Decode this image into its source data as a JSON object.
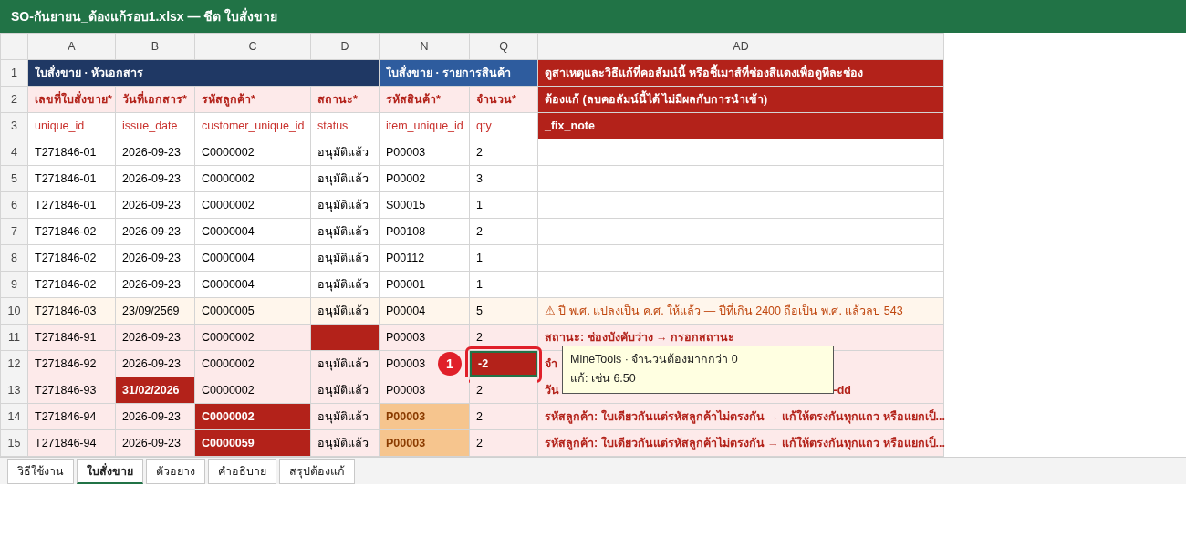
{
  "window": {
    "title": "SO-กันยายน_ต้องแก้รอบ1.xlsx — ชีต ใบสั่งขาย"
  },
  "columns": [
    "A",
    "B",
    "C",
    "D",
    "N",
    "Q",
    "AD"
  ],
  "row_numbers": [
    "1",
    "2",
    "3",
    "4",
    "5",
    "6",
    "7",
    "8",
    "9",
    "10",
    "11",
    "12",
    "13",
    "14",
    "15"
  ],
  "group_headers": [
    {
      "text": "ใบสั่งขาย · หัวเอกสาร",
      "kind": "doc"
    },
    {
      "text": "ใบสั่งขาย · รายการสินค้า",
      "kind": "item"
    },
    {
      "text": "ดูสาเหตุและวิธีแก้ที่คอลัมน์นี้ หรือชี้เมาส์ที่ช่องสีแดงเพื่อดูทีละช่อง",
      "kind": "fix"
    }
  ],
  "labels": [
    {
      "text": "เลขที่ใบสั่งขาย*",
      "kind": "label"
    },
    {
      "text": "วันที่เอกสาร*",
      "kind": "label"
    },
    {
      "text": "รหัสลูกค้า*",
      "kind": "label"
    },
    {
      "text": "สถานะ*",
      "kind": "label"
    },
    {
      "text": "รหัสสินค้า*",
      "kind": "label"
    },
    {
      "text": "จำนวน*",
      "kind": "label"
    },
    {
      "text": "ต้องแก้ (ลบคอลัมน์นี้ได้ ไม่มีผลกับการนำเข้า)",
      "kind": "fix"
    }
  ],
  "fields": [
    {
      "text": "unique_id",
      "kind": "field"
    },
    {
      "text": "issue_date",
      "kind": "field"
    },
    {
      "text": "customer_unique_id",
      "kind": "field"
    },
    {
      "text": "status",
      "kind": "field"
    },
    {
      "text": "item_unique_id",
      "kind": "field"
    },
    {
      "text": "qty",
      "kind": "field"
    },
    {
      "text": "_fix_note",
      "kind": "fix"
    }
  ],
  "rows": [
    {
      "kind": "ok",
      "cells": [
        {
          "t": "T271846-01",
          "kind": "ok",
          "selected": false
        },
        {
          "t": "2026-09-23",
          "kind": "ok",
          "selected": false
        },
        {
          "t": "C0000002",
          "kind": "ok",
          "selected": false
        },
        {
          "t": "อนุมัติแล้ว",
          "kind": "ok",
          "selected": false
        },
        {
          "t": "P00003",
          "kind": "ok",
          "selected": false
        },
        {
          "t": "2",
          "kind": "ok",
          "selected": false
        }
      ]
    },
    {
      "kind": "ok",
      "cells": [
        {
          "t": "T271846-01",
          "kind": "ok",
          "selected": false
        },
        {
          "t": "2026-09-23",
          "kind": "ok",
          "selected": false
        },
        {
          "t": "C0000002",
          "kind": "ok",
          "selected": false
        },
        {
          "t": "อนุมัติแล้ว",
          "kind": "ok",
          "selected": false
        },
        {
          "t": "P00002",
          "kind": "ok",
          "selected": false
        },
        {
          "t": "3",
          "kind": "ok",
          "selected": false
        }
      ]
    },
    {
      "kind": "ok",
      "cells": [
        {
          "t": "T271846-01",
          "kind": "ok",
          "selected": false
        },
        {
          "t": "2026-09-23",
          "kind": "ok",
          "selected": false
        },
        {
          "t": "C0000002",
          "kind": "ok",
          "selected": false
        },
        {
          "t": "อนุมัติแล้ว",
          "kind": "ok",
          "selected": false
        },
        {
          "t": "S00015",
          "kind": "ok",
          "selected": false
        },
        {
          "t": "1",
          "kind": "ok",
          "selected": false
        }
      ]
    },
    {
      "kind": "ok",
      "cells": [
        {
          "t": "T271846-02",
          "kind": "ok",
          "selected": false
        },
        {
          "t": "2026-09-23",
          "kind": "ok",
          "selected": false
        },
        {
          "t": "C0000004",
          "kind": "ok",
          "selected": false
        },
        {
          "t": "อนุมัติแล้ว",
          "kind": "ok",
          "selected": false
        },
        {
          "t": "P00108",
          "kind": "ok",
          "selected": false
        },
        {
          "t": "2",
          "kind": "ok",
          "selected": false
        }
      ]
    },
    {
      "kind": "ok",
      "cells": [
        {
          "t": "T271846-02",
          "kind": "ok",
          "selected": false
        },
        {
          "t": "2026-09-23",
          "kind": "ok",
          "selected": false
        },
        {
          "t": "C0000004",
          "kind": "ok",
          "selected": false
        },
        {
          "t": "อนุมัติแล้ว",
          "kind": "ok",
          "selected": false
        },
        {
          "t": "P00112",
          "kind": "ok",
          "selected": false
        },
        {
          "t": "1",
          "kind": "ok",
          "selected": false
        }
      ]
    },
    {
      "kind": "ok",
      "cells": [
        {
          "t": "T271846-02",
          "kind": "ok",
          "selected": false
        },
        {
          "t": "2026-09-23",
          "kind": "ok",
          "selected": false
        },
        {
          "t": "C0000004",
          "kind": "ok",
          "selected": false
        },
        {
          "t": "อนุมัติแล้ว",
          "kind": "ok",
          "selected": false
        },
        {
          "t": "P00001",
          "kind": "ok",
          "selected": false
        },
        {
          "t": "1",
          "kind": "ok",
          "selected": false
        }
      ]
    },
    {
      "kind": "warn",
      "note": {
        "t": "⚠ ปี พ.ศ. แปลงเป็น ค.ศ. ให้แล้ว — ปีที่เกิน 2400 ถือเป็น พ.ศ. แล้วลบ 543",
        "kind": "warn"
      },
      "cells": [
        {
          "t": "T271846-03",
          "kind": "ok",
          "selected": false
        },
        {
          "t": "23/09/2569",
          "kind": "ok",
          "selected": false
        },
        {
          "t": "C0000005",
          "kind": "ok",
          "selected": false
        },
        {
          "t": "อนุมัติแล้ว",
          "kind": "ok",
          "selected": false
        },
        {
          "t": "P00004",
          "kind": "ok",
          "selected": false
        },
        {
          "t": "5",
          "kind": "ok",
          "selected": false
        }
      ]
    },
    {
      "kind": "error",
      "note": {
        "t": "สถานะ: ช่องบังคับว่าง → กรอกสถานะ",
        "kind": "error"
      },
      "cells": [
        {
          "t": "T271846-91",
          "kind": "ok",
          "selected": false
        },
        {
          "t": "2026-09-23",
          "kind": "ok",
          "selected": false
        },
        {
          "t": "C0000002",
          "kind": "ok",
          "selected": false
        },
        {
          "kind": "error",
          "selected": false
        },
        {
          "t": "P00003",
          "kind": "ok",
          "selected": false
        },
        {
          "t": "2",
          "kind": "ok",
          "selected": false
        }
      ]
    },
    {
      "kind": "error",
      "note": {
        "t": "จำ",
        "kind": "error"
      },
      "cells": [
        {
          "t": "T271846-92",
          "kind": "ok",
          "selected": false
        },
        {
          "t": "2026-09-23",
          "kind": "ok",
          "selected": false
        },
        {
          "t": "C0000002",
          "kind": "ok",
          "selected": false
        },
        {
          "t": "อนุมัติแล้ว",
          "kind": "ok",
          "selected": false
        },
        {
          "t": "P00003",
          "kind": "ok",
          "selected": false
        },
        {
          "t": "-2",
          "kind": "error",
          "selected": true,
          "badge": "1"
        }
      ]
    },
    {
      "kind": "error",
      "note": {
        "t": "วัน",
        "end": "-dd",
        "kind": "error"
      },
      "cells": [
        {
          "t": "T271846-93",
          "kind": "ok",
          "selected": false
        },
        {
          "t": "31/02/2026",
          "kind": "error",
          "selected": false
        },
        {
          "t": "C0000002",
          "kind": "ok",
          "selected": false
        },
        {
          "t": "อนุมัติแล้ว",
          "kind": "ok",
          "selected": false
        },
        {
          "t": "P00003",
          "kind": "ok",
          "selected": false
        },
        {
          "t": "2",
          "kind": "ok",
          "selected": false
        }
      ]
    },
    {
      "kind": "error",
      "note": {
        "t": "รหัสลูกค้า: ใบเดียวกันแต่รหัสลูกค้าไม่ตรงกัน → แก้ให้ตรงกันทุกแถว หรือแยกเป็...",
        "kind": "error"
      },
      "cells": [
        {
          "t": "T271846-94",
          "kind": "ok",
          "selected": false
        },
        {
          "t": "2026-09-23",
          "kind": "ok",
          "selected": false
        },
        {
          "t": "C0000002",
          "kind": "error",
          "selected": false
        },
        {
          "t": "อนุมัติแล้ว",
          "kind": "ok",
          "selected": false
        },
        {
          "t": "P00003",
          "kind": "warn",
          "selected": false
        },
        {
          "t": "2",
          "kind": "ok",
          "selected": false
        }
      ]
    },
    {
      "kind": "error",
      "note": {
        "t": "รหัสลูกค้า: ใบเดียวกันแต่รหัสลูกค้าไม่ตรงกัน → แก้ให้ตรงกันทุกแถว หรือแยกเป็...",
        "kind": "error"
      },
      "cells": [
        {
          "t": "T271846-94",
          "kind": "ok",
          "selected": false
        },
        {
          "t": "2026-09-23",
          "kind": "ok",
          "selected": false
        },
        {
          "t": "C0000059",
          "kind": "error",
          "selected": false
        },
        {
          "t": "อนุมัติแล้ว",
          "kind": "ok",
          "selected": false
        },
        {
          "t": "P00003",
          "kind": "warn",
          "selected": false
        },
        {
          "t": "2",
          "kind": "ok",
          "selected": false
        }
      ]
    }
  ],
  "tooltip": {
    "lines": [
      "MineTools · จำนวนต้องมากกว่า 0",
      "แก้: เช่น 6.50"
    ]
  },
  "sheet_tabs": [
    {
      "label": "วิธีใช้งาน",
      "selected": false
    },
    {
      "label": "ใบสั่งขาย",
      "selected": true
    },
    {
      "label": "ตัวอย่าง",
      "selected": false
    },
    {
      "label": "คำอธิบาย",
      "selected": false
    },
    {
      "label": "สรุปต้องแก้",
      "selected": false
    }
  ]
}
